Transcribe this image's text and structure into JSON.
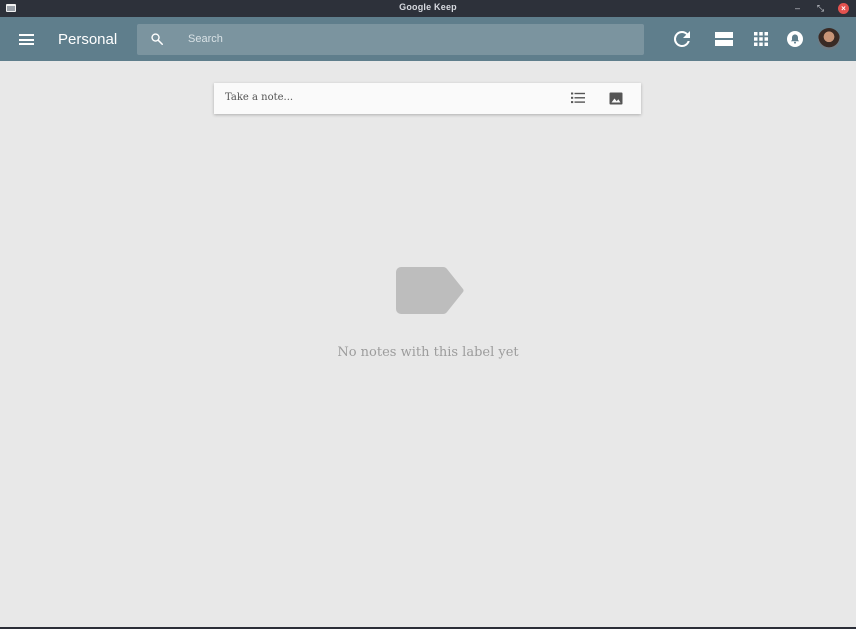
{
  "window": {
    "title": "Google Keep"
  },
  "appbar": {
    "label": "Personal",
    "search_placeholder": "Search"
  },
  "note_input": {
    "placeholder": "Take a note..."
  },
  "empty_state": {
    "message": "No notes with this label yet"
  },
  "colors": {
    "appbar": "#5f7e8c",
    "search_bg": "#7b949f",
    "background": "#e8e8e8",
    "titlebar": "#2d313a",
    "close_button": "#e3524f"
  },
  "icons": [
    "menu-icon",
    "search-icon",
    "refresh-icon",
    "list-view-icon",
    "apps-icon",
    "notifications-icon",
    "avatar",
    "checklist-icon",
    "image-icon",
    "label-icon"
  ]
}
